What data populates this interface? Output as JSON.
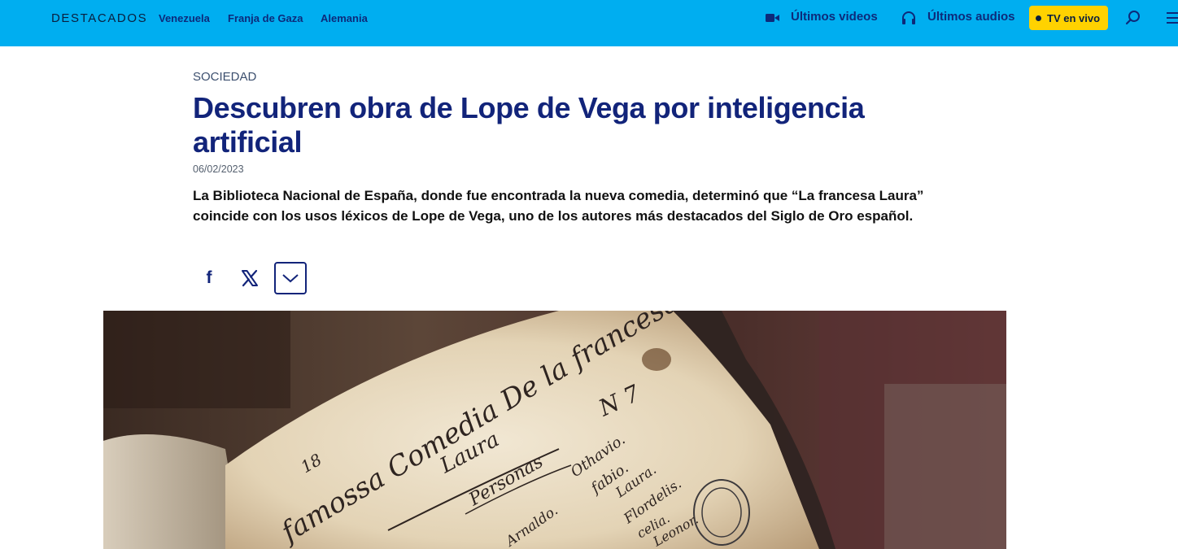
{
  "header": {
    "brand": "DESTACADOS",
    "links": [
      "Venezuela",
      "Franja de Gaza",
      "Alemania"
    ],
    "videos_label": "Últimos videos",
    "audios_label": "Últimos audios",
    "live_label": "TV en vivo",
    "icons": {
      "videos": "video-camera-icon",
      "audios": "headphones-icon",
      "search": "search-icon",
      "menu": "hamburger-menu-icon"
    }
  },
  "article": {
    "section": "SOCIEDAD",
    "title": "Descubren obra de Lope de Vega por inteligencia artificial",
    "date": "06/02/2023",
    "lead": "La Biblioteca Nacional de España, donde fue encontrada la nueva comedia, determinó que “La francesa Laura” coincide con los usos léxicos de Lope de Vega, uno de los autores más destacados del Siglo de Oro español."
  },
  "share": {
    "facebook_glyph": "f",
    "icons": {
      "facebook": "facebook-icon",
      "x": "x-icon",
      "more": "chevron-down-icon"
    }
  },
  "image": {
    "manuscript_lines": [
      "18",
      "famossa Comedia De la francesa",
      "Laura",
      "Personas",
      "N 7",
      "Othavio.",
      "fabio.",
      "Laura.",
      "Flordelis.",
      "celia.",
      "Leonor.",
      "Arnaldo."
    ]
  },
  "colors": {
    "header_bg": "#00aef0",
    "brand_navy": "#12247a",
    "live_badge": "#ffd200"
  }
}
